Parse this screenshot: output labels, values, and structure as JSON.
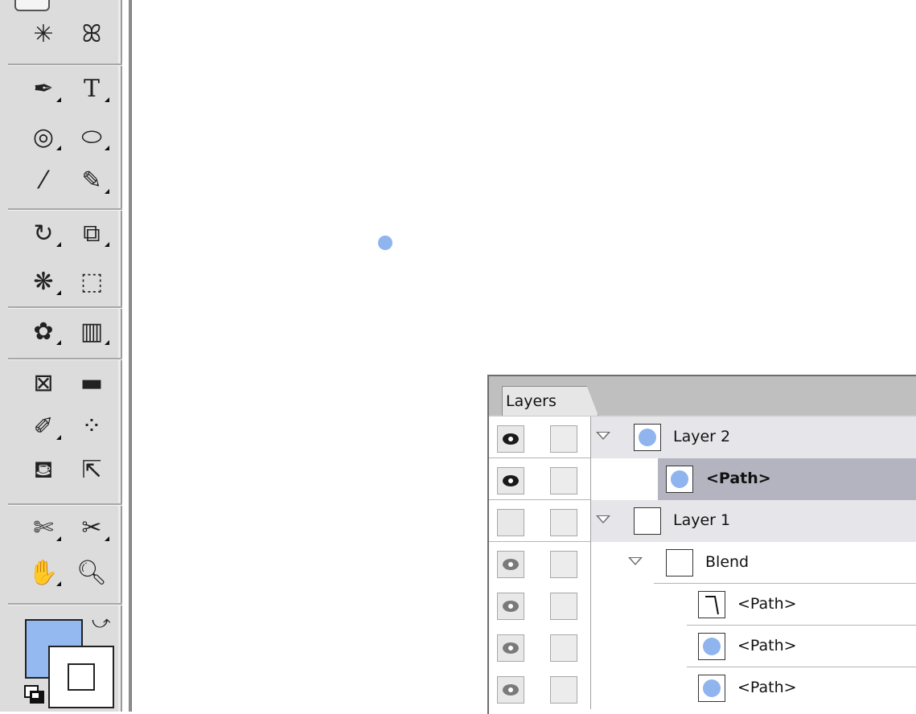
{
  "toolbox": {
    "tools": [
      {
        "name": "magic-wand-tool",
        "glyph": "✳"
      },
      {
        "name": "lasso-tool",
        "glyph": "ꕤ"
      },
      {
        "name": "pen-tool",
        "glyph": "✒"
      },
      {
        "name": "type-tool",
        "glyph": "T"
      },
      {
        "name": "spiral-tool",
        "glyph": "◎"
      },
      {
        "name": "ellipse-tool",
        "glyph": "⬭"
      },
      {
        "name": "paintbrush-tool",
        "glyph": "⁄"
      },
      {
        "name": "pencil-tool",
        "glyph": "✎"
      },
      {
        "name": "rotate-tool",
        "glyph": "↻"
      },
      {
        "name": "scale-tool",
        "glyph": "⧉"
      },
      {
        "name": "warp-tool",
        "glyph": "❋"
      },
      {
        "name": "free-transform-tool",
        "glyph": "⬚"
      },
      {
        "name": "symbol-sprayer-tool",
        "glyph": "✿"
      },
      {
        "name": "column-graph-tool",
        "glyph": "▥"
      },
      {
        "name": "mesh-tool",
        "glyph": "⊠"
      },
      {
        "name": "gradient-tool",
        "glyph": "▬"
      },
      {
        "name": "eyedropper-tool",
        "glyph": "✐"
      },
      {
        "name": "blend-tool",
        "glyph": "⁘"
      },
      {
        "name": "live-paint-bucket-tool",
        "glyph": "⛾"
      },
      {
        "name": "live-paint-selection-tool",
        "glyph": "⇱"
      },
      {
        "name": "slice-tool",
        "glyph": "✄"
      },
      {
        "name": "scissors-tool",
        "glyph": "✂"
      },
      {
        "name": "hand-tool",
        "glyph": "✋"
      },
      {
        "name": "zoom-tool",
        "glyph": "🔍︎"
      }
    ],
    "fill_color": "#93b9f0",
    "stroke_color": "#ffffff"
  },
  "layers_panel": {
    "tab_label": "Layers",
    "rows": [
      {
        "label": "Layer 2",
        "bold": false,
        "visible": "dark",
        "expanded": true,
        "indent": 0,
        "thumb": "circle",
        "style": "normal"
      },
      {
        "label": "<Path>",
        "bold": true,
        "visible": "dark",
        "expanded": null,
        "indent": 1,
        "thumb": "circle",
        "style": "selected"
      },
      {
        "label": "Layer 1",
        "bold": false,
        "visible": "none",
        "expanded": true,
        "indent": 0,
        "thumb": "blank",
        "style": "normal"
      },
      {
        "label": "Blend",
        "bold": false,
        "visible": "dim",
        "expanded": true,
        "indent": 1,
        "thumb": "blank",
        "style": "plain"
      },
      {
        "label": "<Path>",
        "bold": false,
        "visible": "dim",
        "expanded": null,
        "indent": 2,
        "thumb": "line",
        "style": "plain"
      },
      {
        "label": "<Path>",
        "bold": false,
        "visible": "dim",
        "expanded": null,
        "indent": 2,
        "thumb": "circle",
        "style": "plain"
      },
      {
        "label": "<Path>",
        "bold": false,
        "visible": "dim",
        "expanded": null,
        "indent": 2,
        "thumb": "circle",
        "style": "plain"
      }
    ]
  }
}
